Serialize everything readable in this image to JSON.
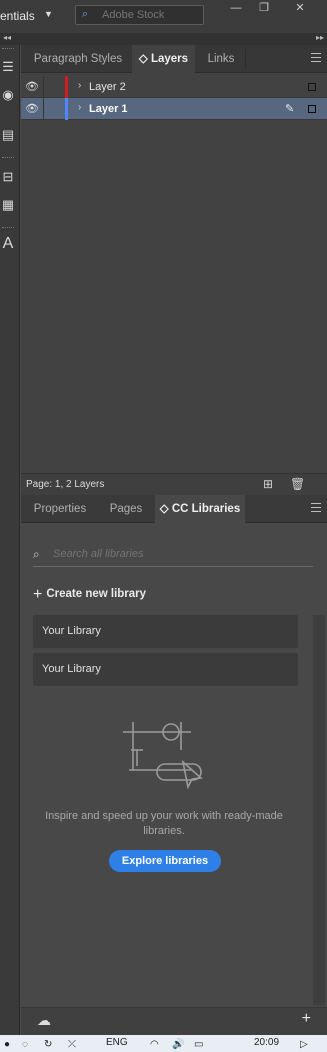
{
  "topbar": {
    "workspace": "entials",
    "search_placeholder": "Adobe Stock",
    "minimize": "—",
    "restore": "❐",
    "close": "✕"
  },
  "strip": {
    "left": "◂◂",
    "right": "▸▸"
  },
  "layers_panel": {
    "tabs": [
      "Paragraph Styles",
      "Layers",
      "Links"
    ],
    "active_tab": "Layers",
    "layers": [
      {
        "name": "Layer 2",
        "color": "#d11d1d",
        "selected": false
      },
      {
        "name": "Layer 1",
        "color": "#4f86ff",
        "selected": true
      }
    ],
    "footer_status": "Page: 1, 2 Layers"
  },
  "libraries_panel": {
    "tabs": [
      "Properties",
      "Pages",
      "CC Libraries"
    ],
    "active_tab": "CC Libraries",
    "search_placeholder": "Search all libraries",
    "create_label": "Create new library",
    "libraries": [
      "Your Library",
      "Your Library"
    ],
    "inspire_text": "Inspire and speed up your work with ready-made libraries.",
    "explore_button": "Explore libraries"
  },
  "taskbar": {
    "language": "ENG",
    "time": "20:09"
  },
  "colors": {
    "accent": "#2f80e6",
    "selection": "#56677f",
    "layer2": "#d11d1d",
    "layer1": "#4f86ff"
  }
}
